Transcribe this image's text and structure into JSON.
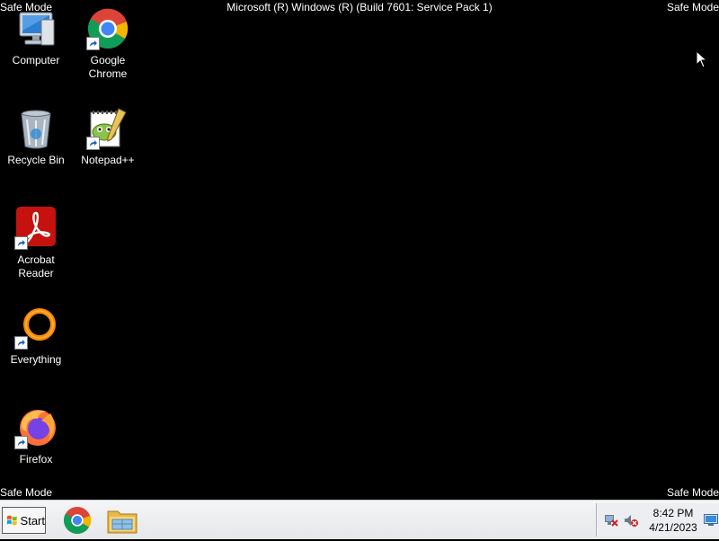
{
  "overlay": {
    "safe_mode_label": "Safe Mode",
    "window_title": "Microsoft (R) Windows (R) (Build 7601: Service Pack 1)"
  },
  "desktop": {
    "icons": [
      {
        "label": "Computer",
        "icon": "computer-icon"
      },
      {
        "label": "Google Chrome",
        "icon": "chrome-icon"
      },
      {
        "label": "Recycle Bin",
        "icon": "recycle-bin-icon"
      },
      {
        "label": "Notepad++",
        "icon": "notepad-plus-plus-icon"
      },
      {
        "label": "Acrobat Reader",
        "icon": "acrobat-reader-icon"
      },
      {
        "label": "Everything",
        "icon": "everything-search-icon"
      },
      {
        "label": "Firefox",
        "icon": "firefox-icon"
      }
    ]
  },
  "taskbar": {
    "start_label": "Start",
    "pinned": [
      {
        "name": "Google Chrome",
        "icon": "chrome-icon"
      },
      {
        "name": "Windows Explorer",
        "icon": "folder-icon"
      }
    ],
    "clock": {
      "time": "8:42 PM",
      "date": "4/21/2023"
    },
    "tray_icons": [
      "network-disconnected-icon",
      "volume-muted-icon",
      "show-desktop-icon"
    ]
  },
  "colors": {
    "desktop_background": "#000000",
    "taskbar_background": "#e9ebee",
    "acrobat_red": "#c5120e",
    "everything_orange": "#ff8a00"
  }
}
